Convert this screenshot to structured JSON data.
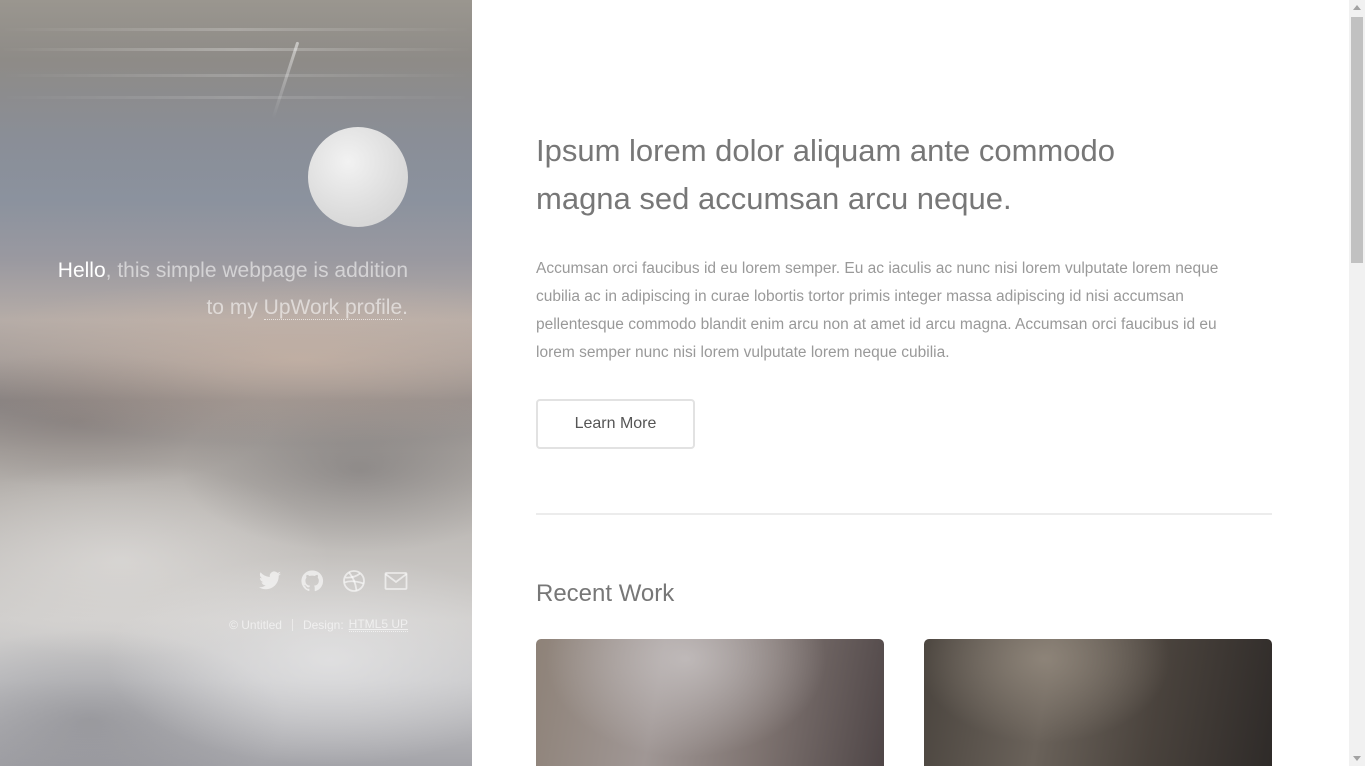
{
  "sidebar": {
    "intro": {
      "hello": "Hello",
      "text_before_link": ", this simple webpage is addition to my ",
      "link_text": "UpWork profile",
      "text_after_link": "."
    },
    "social_icons": [
      "twitter-icon",
      "github-icon",
      "dribbble-icon",
      "envelope-icon"
    ],
    "copyright": {
      "owner": "© Untitled",
      "design_label": "Design:",
      "design_link": "HTML5 UP"
    }
  },
  "main": {
    "headline": "Ipsum lorem dolor aliquam ante commodo magna sed accumsan arcu neque.",
    "body": "Accumsan orci faucibus id eu lorem semper. Eu ac iaculis ac nunc nisi lorem vulputate lorem neque cubilia ac in adipiscing in curae lobortis tortor primis integer massa adipiscing id nisi accumsan pellentesque commodo blandit enim arcu non at amet id arcu magna. Accumsan orci faucibus id eu lorem semper nunc nisi lorem vulputate lorem neque cubilia.",
    "button_label": "Learn More",
    "section_title": "Recent Work"
  },
  "colors": {
    "heading": "#777777",
    "body_text": "#999999",
    "button_border": "#e2e2e2",
    "divider": "#ececec"
  }
}
